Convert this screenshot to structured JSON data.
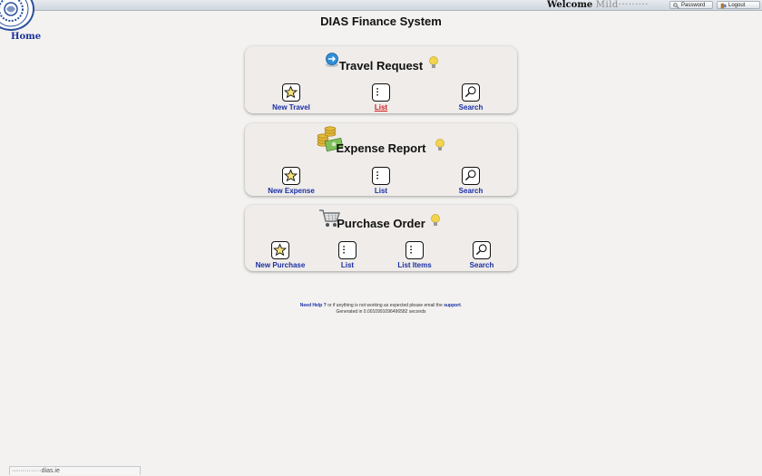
{
  "header": {
    "welcome_label": "Welcome",
    "welcome_user": "Mild·········",
    "password_label": "Password",
    "logout_label": "Logout"
  },
  "nav": {
    "home_label": "Home"
  },
  "page": {
    "title": "DIAS Finance System"
  },
  "sections": {
    "travel": {
      "title": "Travel Request",
      "actions": {
        "new": "New Travel",
        "list": "List",
        "search": "Search"
      }
    },
    "expense": {
      "title": "Expense Report",
      "actions": {
        "new": "New Expense",
        "list": "List",
        "search": "Search"
      }
    },
    "purchase": {
      "title": "Purchase Order",
      "actions": {
        "new": "New Purchase",
        "list": "List",
        "list_items": "List Items",
        "search": "Search"
      }
    }
  },
  "footer": {
    "help_link": "Need Help ?",
    "help_text": " or if anything is not working as expected please email the ",
    "support_link": "support",
    "period": ".",
    "generated": "Generated in 0.0010991096496582 seconds"
  },
  "status_bar": {
    "url": "··············dias.ie"
  },
  "colors": {
    "link": "#1a2fa6",
    "active_link": "#cc1c1c",
    "panel_bg": "#efece9",
    "page_bg": "#f3f2f0"
  }
}
